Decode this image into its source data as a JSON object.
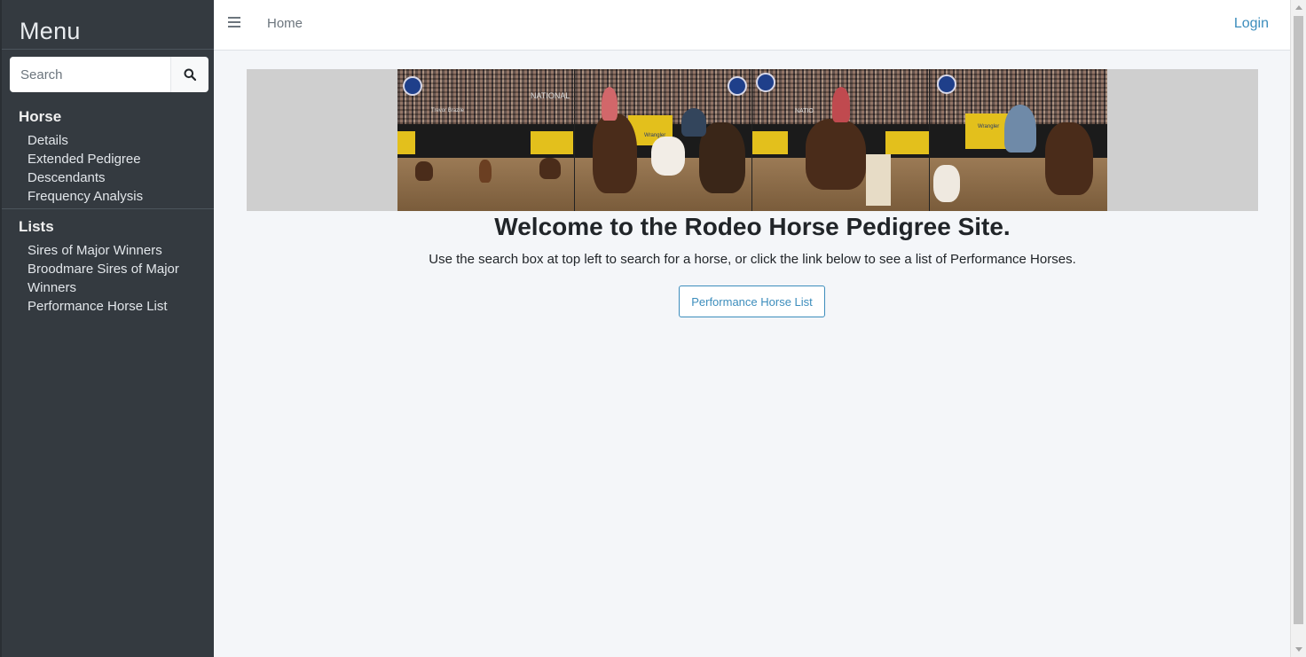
{
  "sidebar": {
    "brand": "Menu",
    "search": {
      "placeholder": "Search"
    },
    "sections": [
      {
        "header": "Horse",
        "items": [
          "Details",
          "Extended Pedigree",
          "Descendants",
          "Frequency Analysis"
        ]
      },
      {
        "header": "Lists",
        "items": [
          "Sires of Major Winners",
          "Broodmare Sires of Major Winners",
          "Performance Horse List"
        ]
      }
    ]
  },
  "topbar": {
    "home": "Home",
    "login": "Login"
  },
  "main": {
    "welcome": "Welcome to the Rodeo Horse Pedigree Site.",
    "subtitle": "Use the search box at top left to search for a horse, or click the link below to see a list of Performance Horses.",
    "button_label": "Performance Horse List",
    "banner_text": [
      "NATIONAL",
      "Trevor Brazile",
      "Wrangler",
      "NATIO",
      "Wrangler"
    ]
  },
  "colors": {
    "accent": "#3c8dbc",
    "sidebar": "#343a40",
    "content_bg": "#f4f6f9"
  }
}
